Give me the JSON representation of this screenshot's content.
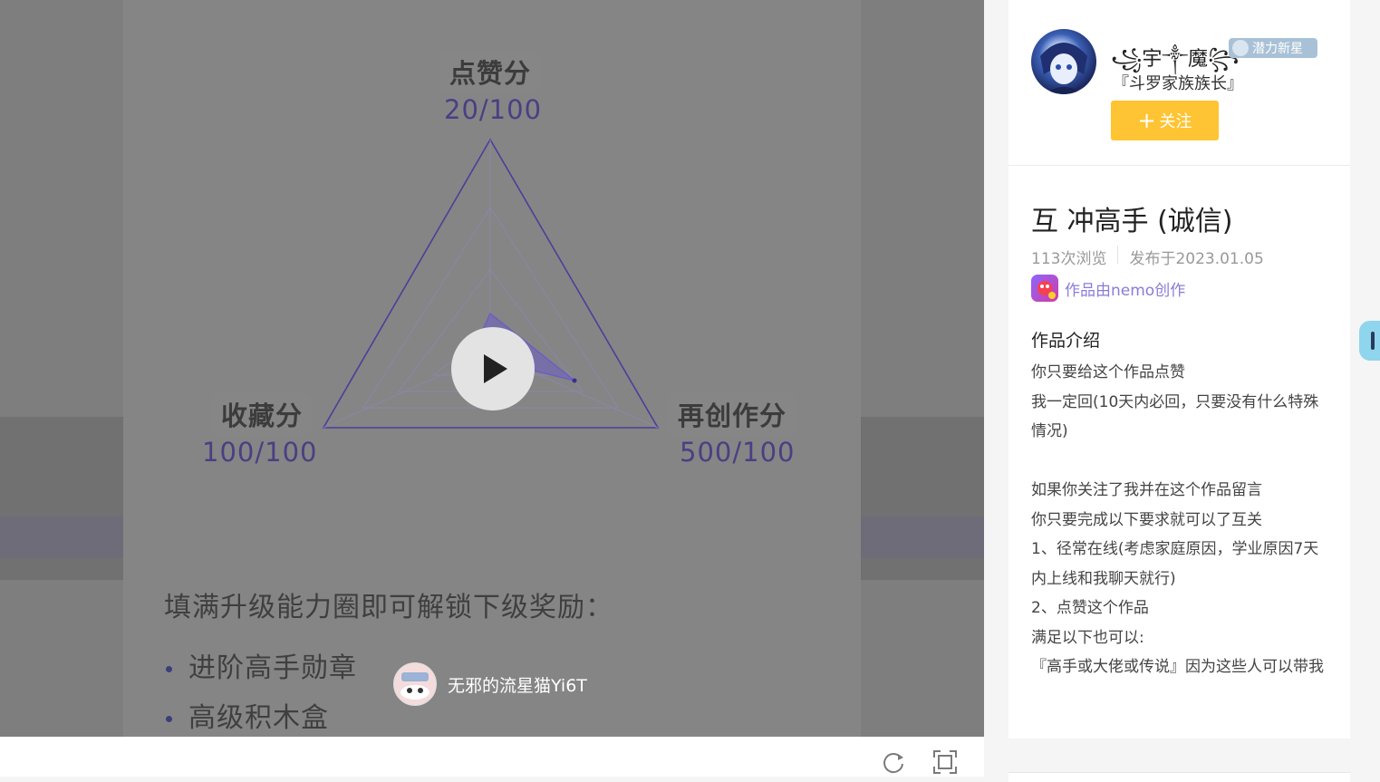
{
  "preview": {
    "radar_axes": [
      {
        "name": "点赞分",
        "value": "20/100"
      },
      {
        "name": "收藏分",
        "value": "100/100"
      },
      {
        "name": "再创作分",
        "value": "500/100"
      }
    ],
    "unlock_hint": "填满升级能力圈即可解锁下级奖励：",
    "rewards": [
      "进阶高手勋章",
      "高级积木盒"
    ],
    "author_chip_name": "无邪的流星猫Yi6T"
  },
  "author": {
    "name": "꧁宇༒魔꧂",
    "badge": "潜力新星",
    "title": "『斗罗家族族长』",
    "follow_label": "关注"
  },
  "work": {
    "title": "互 冲高手 (诚信)",
    "views": "113次浏览",
    "published": "发布于2023.01.05",
    "created_with": "作品由nemo创作",
    "intro_heading": "作品介绍",
    "intro_lines": [
      "你只要给这个作品点赞",
      "我一定回(10天内必回，只要没有什么特殊情况)",
      "",
      "如果你关注了我并在这个作品留言",
      "你只要完成以下要求就可以了互关",
      "1、径常在线(考虑家庭原因，学业原因7天内上线和我聊天就行)",
      "2、点赞这个作品",
      "满足以下也可以:",
      "『高手或大佬或传说』因为这些人可以带我"
    ]
  },
  "colors": {
    "accent_follow": "#fec433",
    "nemo_link": "#8b7bd8",
    "radar_line": "#4a3f9a"
  },
  "icons": [
    "play-icon",
    "refresh-icon",
    "fullscreen-icon",
    "plus-icon",
    "badge-star-icon",
    "nemo-logo-icon"
  ]
}
